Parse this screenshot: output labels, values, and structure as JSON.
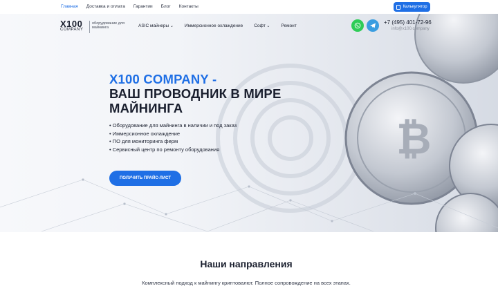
{
  "topbar": {
    "links": [
      "Главная",
      "Доставка и оплата",
      "Гарантии",
      "Блог",
      "Контакты"
    ],
    "calculator_label": "Калькулятор"
  },
  "header": {
    "logo_main": "X100",
    "logo_sub": "COMPANY",
    "tagline": "оборудование для майнинга",
    "menu": [
      "ASIC майнеры",
      "Иммерсионное охлаждение",
      "Софт",
      "Ремонт"
    ],
    "phone": "+7 (495) 401-72-96",
    "email": "info@x100.company"
  },
  "hero": {
    "title_accent": "X100 COMPANY -",
    "title_line2": "ВАШ ПРОВОДНИК В МИРЕ",
    "title_line3": "МАЙНИНГА",
    "bullets": [
      "Оборудование для майнинга в наличии и под заказ",
      "Иммерсионное охлаждение",
      "ПО для мониторинга ферм",
      "Сервисный центр по ремонту оборудования"
    ],
    "cta_label": "ПОЛУЧИТЬ ПРАЙС-ЛИСТ"
  },
  "directions": {
    "title": "Наши направления",
    "description": "Комплексный подход к майнингу криптовалют. Полное сопровождение на всех этапах."
  },
  "colors": {
    "accent": "#1f6fe5",
    "whatsapp": "#2ecc57",
    "telegram": "#3a9de0"
  }
}
